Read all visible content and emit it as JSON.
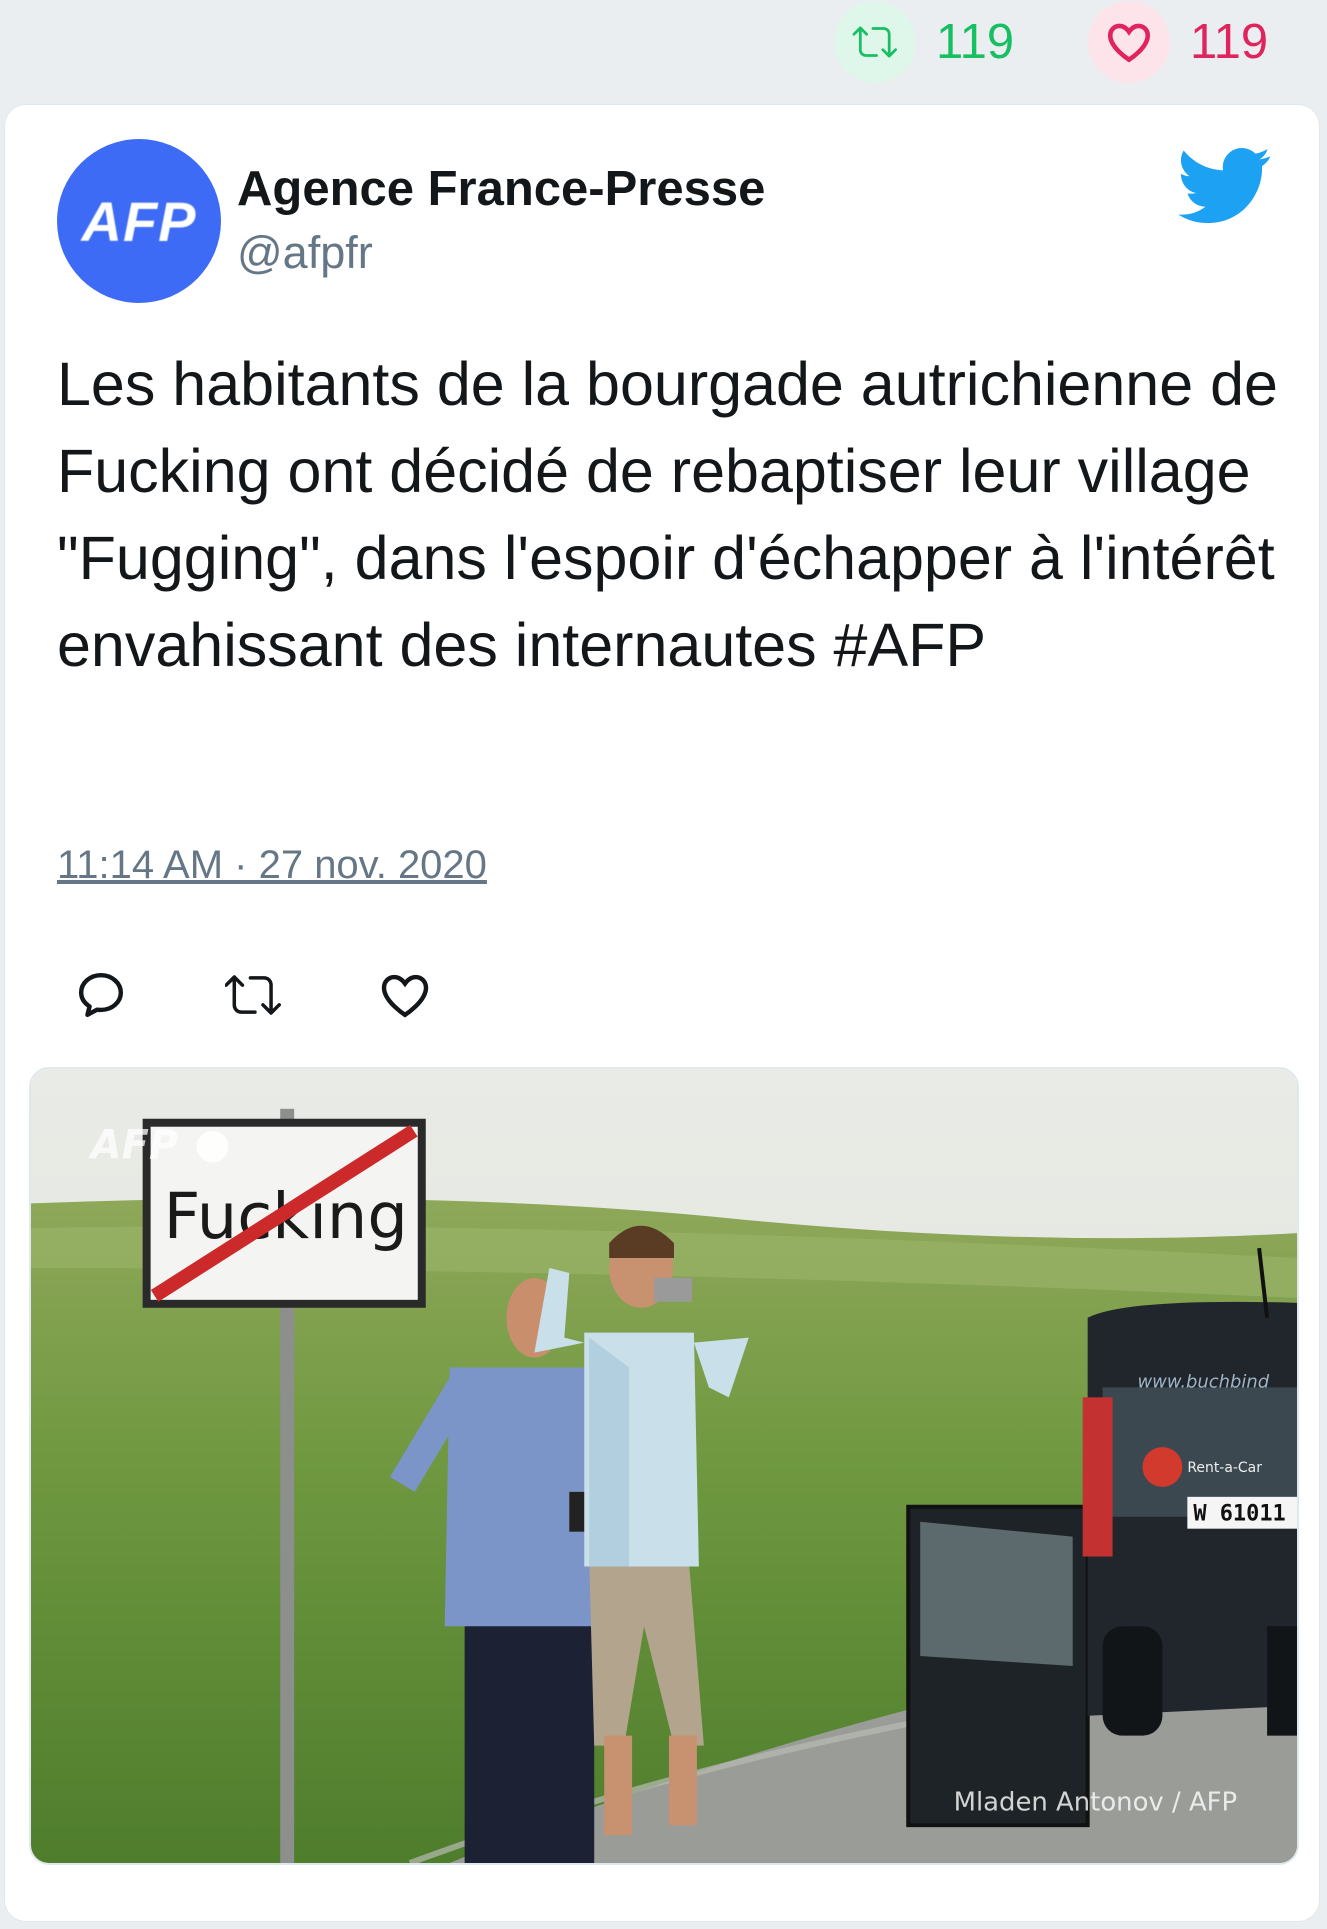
{
  "stats": {
    "retweet_count": "119",
    "like_count": "119"
  },
  "author": {
    "avatar_text": "AFP",
    "name": "Agence France-Presse",
    "handle": "@afpfr"
  },
  "tweet": {
    "text": "Les habitants de la bourgade autrichienne de Fucking ont décidé de rebaptiser leur village \"Fugging\", dans l'espoir d'échapper à l'intérêt envahissant des internautes #AFP",
    "timestamp": "11:14 AM · 27 nov. 2020"
  },
  "media": {
    "sign_text": "Fucking",
    "watermark": "AFP",
    "credit": "Mladen Antonov / AFP",
    "car_website": "www.buchbind",
    "car_rental_label": "Rent-a-Car",
    "car_plate": "W 61011"
  },
  "colors": {
    "retweet_green": "#17bf63",
    "like_red": "#e0245e",
    "twitter_blue": "#1da1f2",
    "afp_blue": "#3d6bf5"
  },
  "icons": {
    "retweet": "retweet-icon",
    "like": "heart-icon",
    "reply": "reply-icon",
    "brand": "twitter-bird-icon"
  }
}
